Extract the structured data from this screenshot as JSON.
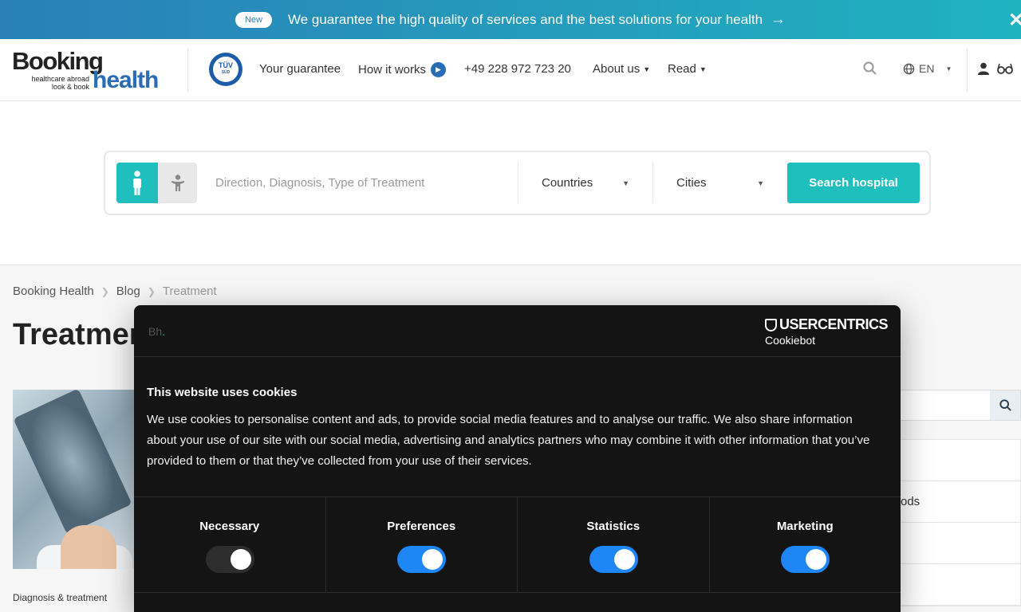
{
  "announcement": {
    "badge": "New",
    "message": "We guarantee the high quality of services and the best solutions for your health",
    "arrow_icon": "arrow-right-icon",
    "close_icon": "close-icon"
  },
  "header": {
    "logo": {
      "word1": "Booking",
      "tagline1": "healthcare abroad",
      "tagline2": "look & book",
      "word2": "health"
    },
    "tuv": {
      "text": "TÜV",
      "subtext": "SÜD"
    },
    "nav": {
      "guarantee": "Your guarantee",
      "how_it_works": "How it works",
      "phone": "+49 228 972 723 20",
      "about": "About us",
      "read": "Read"
    },
    "language": "EN",
    "icons": [
      "search-icon",
      "globe-icon",
      "user-icon",
      "glasses-icon"
    ]
  },
  "search": {
    "placeholder": "Direction, Diagnosis, Type of Treatment",
    "countries": "Countries",
    "cities": "Cities",
    "button": "Search hospital"
  },
  "breadcrumb": [
    "Booking Health",
    "Blog",
    "Treatment"
  ],
  "page_title": "Treatments",
  "article": {
    "category": "Diagnosis & treatment"
  },
  "sidebar": {
    "items": [
      "",
      "ods",
      "",
      ""
    ]
  },
  "cookie": {
    "brand_short": "Bh",
    "brand_dot": ".",
    "provider": "USERCENTRICS",
    "provider_sub": "Cookiebot",
    "title": "This website uses cookies",
    "body": "We use cookies to personalise content and ads, to provide social media features and to analyse our traffic. We also share information about your use of our site with our social media, advertising and analytics partners who may combine it with other information that you’ve provided to them or that they’ve collected from your use of their services.",
    "categories": [
      {
        "label": "Necessary",
        "enabled": true,
        "disabled": true
      },
      {
        "label": "Preferences",
        "enabled": true,
        "disabled": false
      },
      {
        "label": "Statistics",
        "enabled": true,
        "disabled": false
      },
      {
        "label": "Marketing",
        "enabled": true,
        "disabled": false
      }
    ],
    "accent_color": "#1e86f5"
  },
  "colors": {
    "teal": "#1fbfbd",
    "brand_blue": "#2a6db5"
  }
}
